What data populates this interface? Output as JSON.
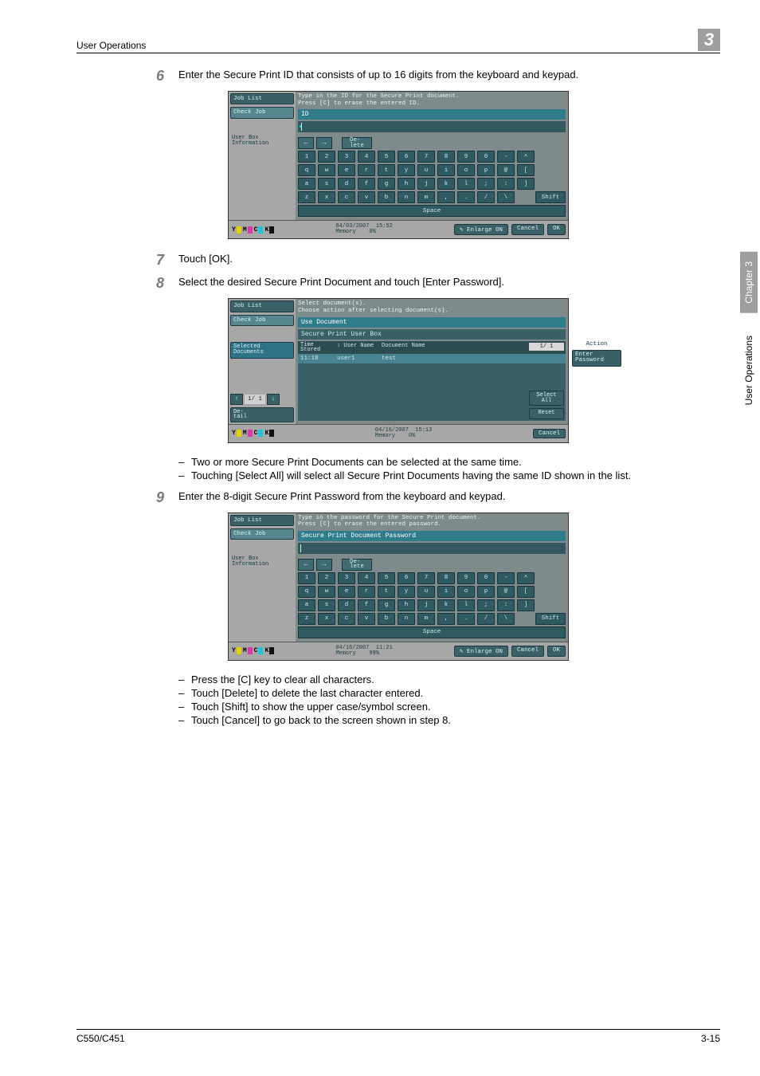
{
  "header": {
    "section": "User Operations",
    "chapter_badge": "3"
  },
  "side": {
    "chapter": "Chapter 3",
    "section": "User Operations"
  },
  "footer": {
    "model": "C550/C451",
    "page": "3-15"
  },
  "steps": {
    "s6": {
      "num": "6",
      "text": "Enter the Secure Print ID that consists of up to 16 digits from the keyboard and keypad."
    },
    "s7": {
      "num": "7",
      "text": "Touch [OK]."
    },
    "s8": {
      "num": "8",
      "text": "Select the desired Secure Print Document and touch [Enter Password]."
    },
    "s9": {
      "num": "9",
      "text": "Enter the 8-digit Secure Print Password from the keyboard and keypad."
    }
  },
  "bullets8": [
    "Two or more Secure Print Documents can be selected at the same time.",
    "Touching [Select All] will select all Secure Print Documents having the same ID shown in the list."
  ],
  "bullets9": [
    "Press the [C] key to clear all characters.",
    "Touch [Delete] to delete the last character entered.",
    "Touch [Shift] to show the upper case/symbol screen.",
    "Touch [Cancel] to go back to the screen shown in step 8."
  ],
  "scr1": {
    "side": {
      "job_list": "Job List",
      "check_job": "Check Job",
      "userbox": "User Box\nInformation"
    },
    "instr": "Type in the ID for the Secure Print document.\nPress [C] to erase the entered ID.",
    "tab": "ID",
    "delete": "De-\nlete",
    "row1": [
      "1",
      "2",
      "3",
      "4",
      "5",
      "6",
      "7",
      "8",
      "9",
      "0",
      "-",
      "^"
    ],
    "row2": [
      "q",
      "w",
      "e",
      "r",
      "t",
      "y",
      "u",
      "i",
      "o",
      "p",
      "@",
      "["
    ],
    "row3": [
      "a",
      "s",
      "d",
      "f",
      "g",
      "h",
      "j",
      "k",
      "l",
      ";",
      ":",
      "]"
    ],
    "row4": [
      "z",
      "x",
      "c",
      "v",
      "b",
      "n",
      "m",
      ",",
      ".",
      "/",
      "\\"
    ],
    "shift": "Shift",
    "space": "Space",
    "footer": {
      "date": "04/03/2007",
      "time": "15:52",
      "mem_lbl": "Memory",
      "mem": "0%",
      "enlarge": "Enlarge ON",
      "cancel": "Cancel",
      "ok": "OK"
    }
  },
  "scr2": {
    "side": {
      "job_list": "Job List",
      "check_job": "Check Job",
      "sel_docs": "Selected Documents",
      "page": "1/ 1",
      "detail": "De-\ntail"
    },
    "instr": "Select document(s).\nChoose action after selecting document(s).",
    "tab1": "Use Document",
    "tab2": "Secure Print User Box",
    "head": {
      "time": "Time\nStored",
      "user": "User Name",
      "doc": "Document Name"
    },
    "row": {
      "time": "11:18",
      "user": "user1",
      "doc": "test"
    },
    "page_ind": "1/ 1",
    "select_all": "Select\nAll",
    "reset": "Reset",
    "action_lbl": "Action",
    "enter_pw": "Enter\nPassword",
    "footer": {
      "date": "04/16/2007",
      "time": "15:13",
      "mem_lbl": "Memory",
      "mem": "0%",
      "cancel": "Cancel"
    }
  },
  "scr3": {
    "side": {
      "job_list": "Job List",
      "check_job": "Check Job",
      "userbox": "User Box\nInformation"
    },
    "instr": "Type in the password for the Secure Print document.\nPress [C] to erase the entered password.",
    "tab": "Secure Print Document Password",
    "delete": "De-\nlete",
    "row1": [
      "1",
      "2",
      "3",
      "4",
      "5",
      "6",
      "7",
      "8",
      "9",
      "0",
      "-",
      "^"
    ],
    "row2": [
      "q",
      "w",
      "e",
      "r",
      "t",
      "y",
      "u",
      "i",
      "o",
      "p",
      "@",
      "["
    ],
    "row3": [
      "a",
      "s",
      "d",
      "f",
      "g",
      "h",
      "j",
      "k",
      "l",
      ";",
      ":",
      "]"
    ],
    "row4": [
      "z",
      "x",
      "c",
      "v",
      "b",
      "n",
      "m",
      ",",
      ".",
      "/",
      "\\"
    ],
    "shift": "Shift",
    "space": "Space",
    "footer": {
      "date": "04/16/2007",
      "time": "11:21",
      "mem_lbl": "Memory",
      "mem": "99%",
      "enlarge": "Enlarge ON",
      "cancel": "Cancel",
      "ok": "OK"
    }
  }
}
